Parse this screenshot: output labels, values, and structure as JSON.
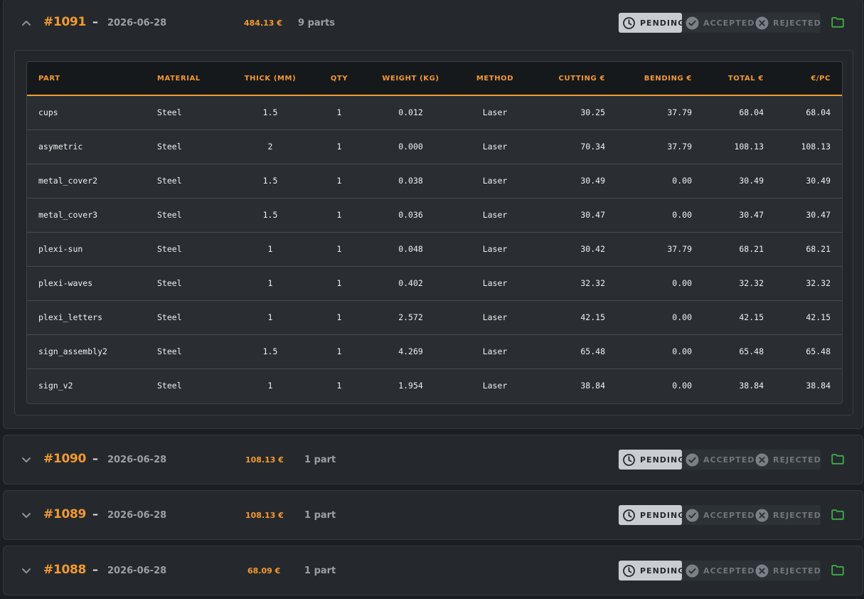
{
  "orders": [
    {
      "id": "#1091",
      "dash": "–",
      "date": "2026-06-28",
      "price": "484.13 €",
      "parts": "9 parts",
      "expanded": true
    },
    {
      "id": "#1090",
      "dash": "–",
      "date": "2026-06-28",
      "price": "108.13 €",
      "parts": "1 part",
      "expanded": false
    },
    {
      "id": "#1089",
      "dash": "–",
      "date": "2026-06-28",
      "price": "108.13 €",
      "parts": "1 part",
      "expanded": false
    },
    {
      "id": "#1088",
      "dash": "–",
      "date": "2026-06-28",
      "price": "68.09 €",
      "parts": "1 part",
      "expanded": false
    }
  ],
  "status": {
    "pending": "PENDING",
    "accepted": "ACCEPTED",
    "rejected": "REJECTED",
    "active": "pending"
  },
  "icons": {
    "expand": "chevron-up-icon",
    "collapse": "chevron-down-icon",
    "pending": "clock-icon",
    "accepted": "check-circle-icon",
    "rejected": "x-circle-icon",
    "folder": "folder-icon"
  },
  "colors": {
    "accent": "#f39a2e",
    "folder": "#3fae49",
    "pending_bg": "#c9ccd0"
  },
  "table": {
    "columns": [
      "PART",
      "MATERIAL",
      "THICK (MM)",
      "QTY",
      "WEIGHT (KG)",
      "METHOD",
      "CUTTING €",
      "BENDING €",
      "TOTAL €",
      "€/PC"
    ],
    "rows": [
      [
        "cups",
        "Steel",
        "1.5",
        "1",
        "0.012",
        "Laser",
        "30.25",
        "37.79",
        "68.04",
        "68.04"
      ],
      [
        "asymetric",
        "Steel",
        "2",
        "1",
        "0.000",
        "Laser",
        "70.34",
        "37.79",
        "108.13",
        "108.13"
      ],
      [
        "metal_cover2",
        "Steel",
        "1.5",
        "1",
        "0.038",
        "Laser",
        "30.49",
        "0.00",
        "30.49",
        "30.49"
      ],
      [
        "metal_cover3",
        "Steel",
        "1.5",
        "1",
        "0.036",
        "Laser",
        "30.47",
        "0.00",
        "30.47",
        "30.47"
      ],
      [
        "plexi-sun",
        "Steel",
        "1",
        "1",
        "0.048",
        "Laser",
        "30.42",
        "37.79",
        "68.21",
        "68.21"
      ],
      [
        "plexi-waves",
        "Steel",
        "1",
        "1",
        "0.402",
        "Laser",
        "32.32",
        "0.00",
        "32.32",
        "32.32"
      ],
      [
        "plexi_letters",
        "Steel",
        "1",
        "1",
        "2.572",
        "Laser",
        "42.15",
        "0.00",
        "42.15",
        "42.15"
      ],
      [
        "sign_assembly2",
        "Steel",
        "1.5",
        "1",
        "4.269",
        "Laser",
        "65.48",
        "0.00",
        "65.48",
        "65.48"
      ],
      [
        "sign_v2",
        "Steel",
        "1",
        "1",
        "1.954",
        "Laser",
        "38.84",
        "0.00",
        "38.84",
        "38.84"
      ]
    ]
  }
}
